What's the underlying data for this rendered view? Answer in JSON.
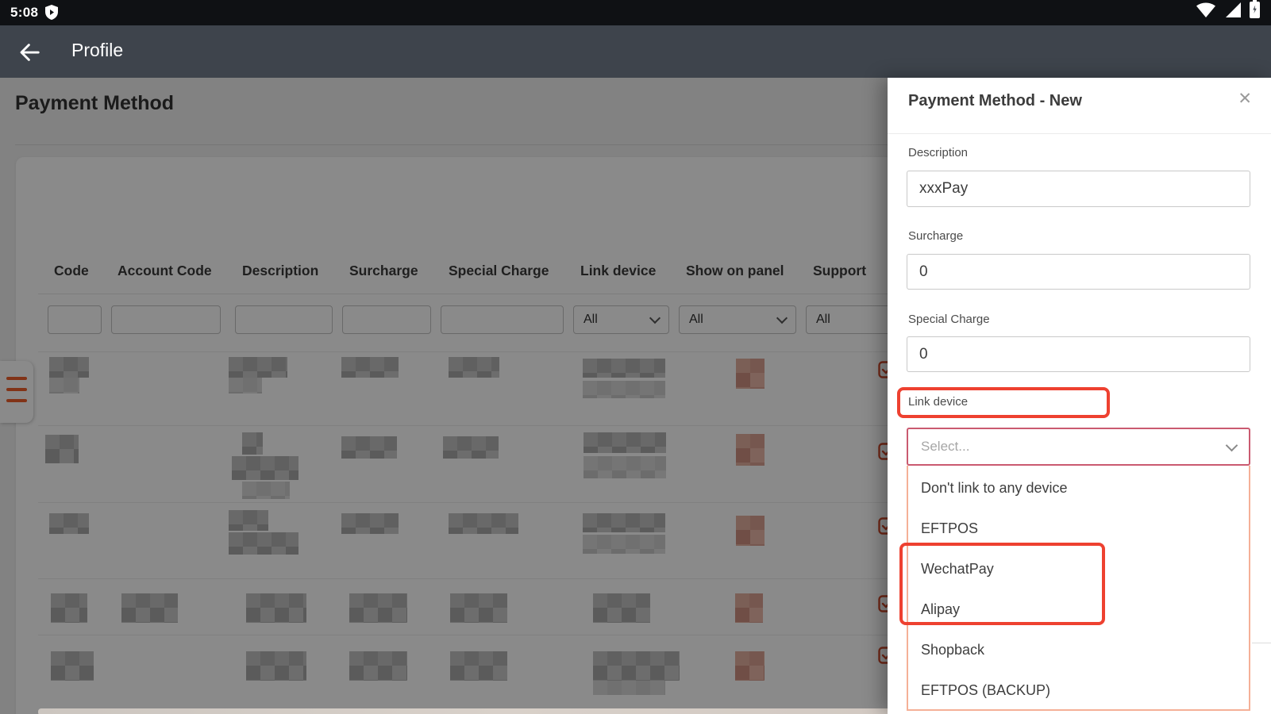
{
  "status_bar": {
    "time": "5:08"
  },
  "app_bar": {
    "title": "Profile"
  },
  "page": {
    "title": "Payment Method",
    "table": {
      "columns": [
        "Code",
        "Account Code",
        "Description",
        "Surcharge",
        "Special Charge",
        "Link device",
        "Show on panel",
        "Support"
      ],
      "filters": {
        "link_device": "All",
        "show_on_panel": "All",
        "support": "All"
      }
    }
  },
  "panel": {
    "title": "Payment Method - New",
    "close_icon": "✕",
    "fields": [
      {
        "label": "Description",
        "value": "xxxPay"
      },
      {
        "label": "Surcharge",
        "value": "0"
      },
      {
        "label": "Special Charge",
        "value": "0"
      }
    ],
    "link_device": {
      "label": "Link device",
      "placeholder": "Select...",
      "options": [
        "Don't link to any device",
        "EFTPOS",
        "WechatPay",
        "Alipay",
        "Shopback",
        "EFTPOS (BACKUP)"
      ],
      "highlighted_options": [
        "WechatPay",
        "Alipay"
      ]
    }
  },
  "colors": {
    "annotation_red": "#ee4130",
    "select_border_rose": "#ca5a70",
    "dropdown_border_salmon": "#f5b097",
    "table_check_red": "#d14a2c",
    "drawer_hamburger_orange": "#ee5f2b",
    "app_bar": "#3e444c"
  }
}
